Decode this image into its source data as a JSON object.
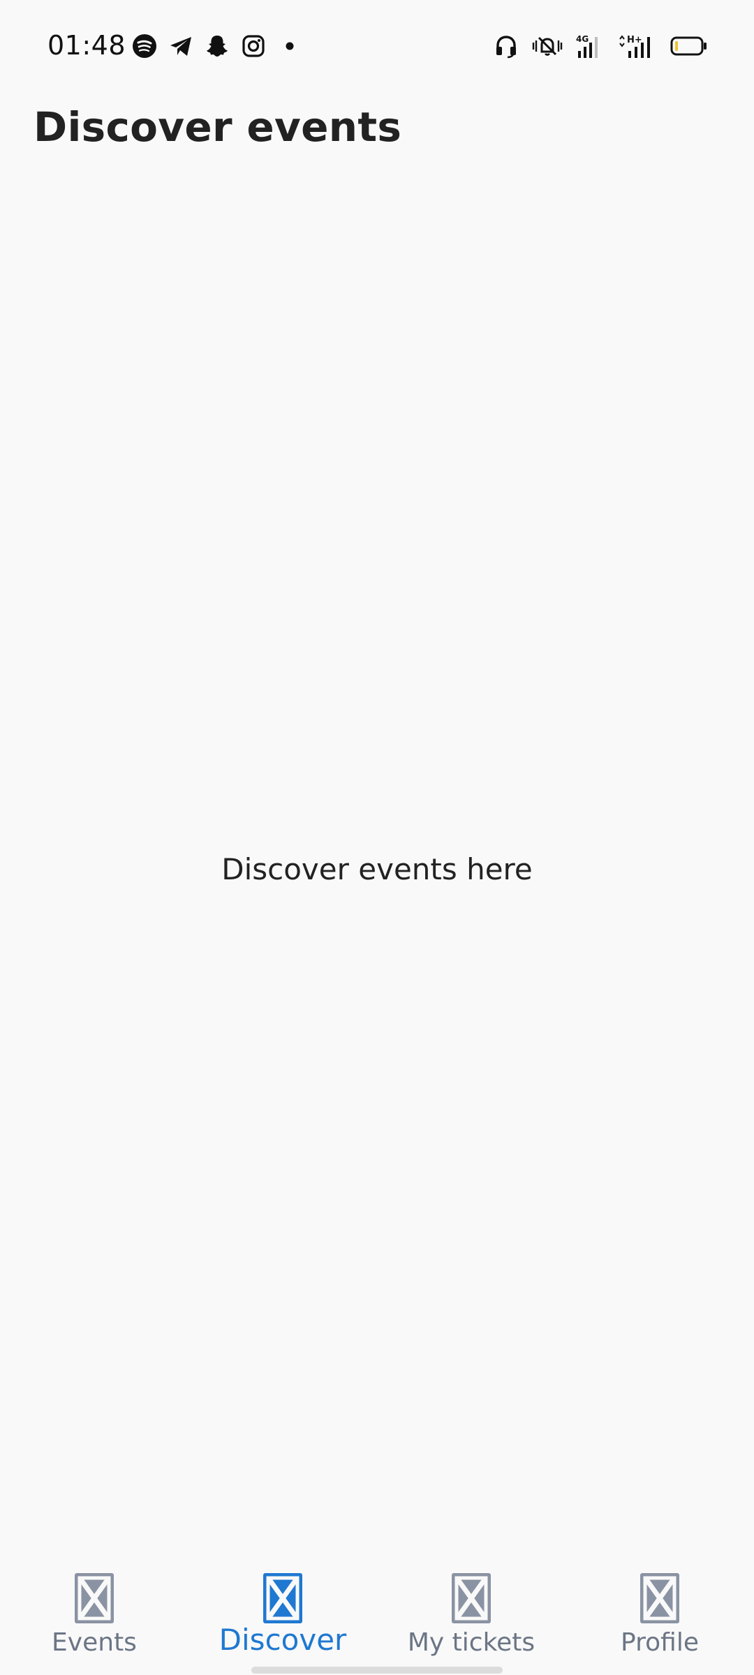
{
  "status_bar": {
    "time": "01:48",
    "left_icons": [
      "spotify-icon",
      "telegram-icon",
      "snapchat-icon",
      "instagram-icon",
      "notification-dot-icon"
    ],
    "right_icons": [
      "headset-icon",
      "vibrate-mute-icon",
      "signal-4g-icon",
      "signal-hplus-icon",
      "battery-icon"
    ],
    "network_1": "4G",
    "network_2": "H+"
  },
  "header": {
    "title": "Discover events"
  },
  "main": {
    "empty_message": "Discover events here"
  },
  "bottom_nav": {
    "active": "Discover",
    "active_color": "#1f78d1",
    "inactive_color": "#8a93a3",
    "items": [
      {
        "label": "Events",
        "icon": "placeholder-icon"
      },
      {
        "label": "Discover",
        "icon": "placeholder-icon"
      },
      {
        "label": "My tickets",
        "icon": "placeholder-icon"
      },
      {
        "label": "Profile",
        "icon": "placeholder-icon"
      }
    ]
  }
}
